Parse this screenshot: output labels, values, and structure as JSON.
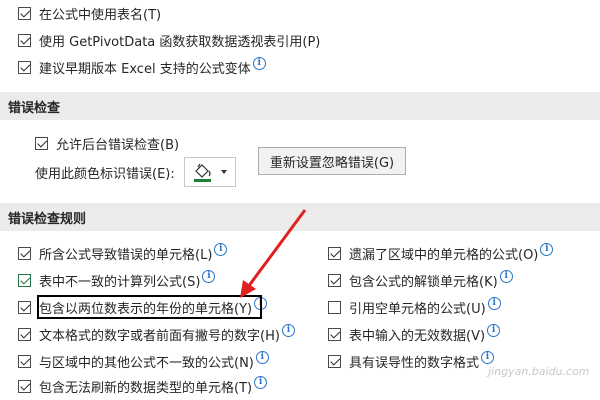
{
  "formulas": {
    "items": [
      {
        "label": "在公式中使用表名(T)",
        "checked": true,
        "info": false
      },
      {
        "label": "使用 GetPivotData 函数获取数据透视表引用(P)",
        "checked": true,
        "info": false
      },
      {
        "label": "建议早期版本 Excel 支持的公式变体",
        "checked": true,
        "info": true
      }
    ]
  },
  "error_checking": {
    "title": "错误检查",
    "enable_background_label": "允许后台错误检查(B)",
    "color_label": "使用此颜色标识错误(E):",
    "color_value": "#1a7f37",
    "reset_button_label": "重新设置忽略错误(G)"
  },
  "rules": {
    "title": "错误检查规则",
    "left": [
      {
        "label": "所含公式导致错误的单元格(L)",
        "checked": true
      },
      {
        "label": "表中不一致的计算列公式(S)",
        "checked": true,
        "green": true
      },
      {
        "label": "包含以两位数表示的年份的单元格(Y)",
        "checked": true
      },
      {
        "label": "文本格式的数字或者前面有撇号的数字(H)",
        "checked": true
      },
      {
        "label": "与区域中的其他公式不一致的公式(N)",
        "checked": true
      },
      {
        "label": "包含无法刷新的数据类型的单元格(T)",
        "checked": true
      }
    ],
    "right": [
      {
        "label": "遗漏了区域中的单元格的公式(O)",
        "checked": true
      },
      {
        "label": "包含公式的解锁单元格(K)",
        "checked": true
      },
      {
        "label": "引用空单元格的公式(U)",
        "checked": false
      },
      {
        "label": "表中输入的无效数据(V)",
        "checked": true
      },
      {
        "label": "具有误导性的数字格式",
        "checked": true
      }
    ]
  },
  "annotation": {
    "arrow_color": "#e02020"
  },
  "watermark": "jingyan.baidu.com"
}
